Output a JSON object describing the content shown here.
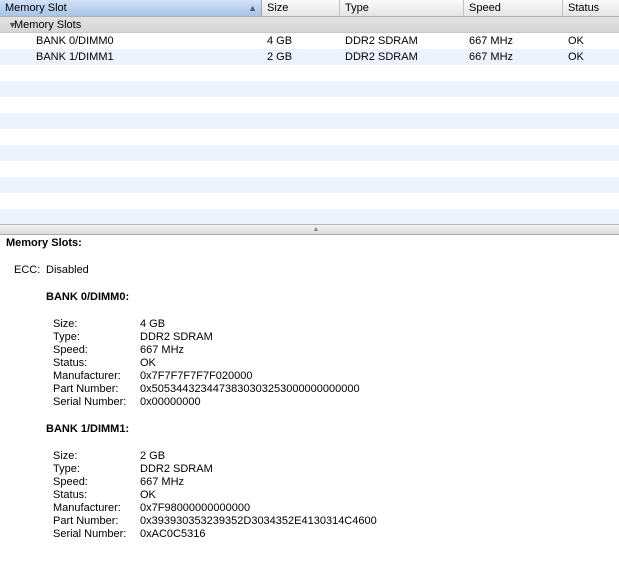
{
  "table": {
    "columns": [
      {
        "label": "Memory Slot"
      },
      {
        "label": "Size"
      },
      {
        "label": "Type"
      },
      {
        "label": "Speed"
      },
      {
        "label": "Status"
      }
    ],
    "group_label": "Memory Slots",
    "rows": [
      {
        "slot": "BANK 0/DIMM0",
        "size": "4 GB",
        "type": "DDR2 SDRAM",
        "speed": "667 MHz",
        "status": "OK"
      },
      {
        "slot": "BANK 1/DIMM1",
        "size": "2 GB",
        "type": "DDR2 SDRAM",
        "speed": "667 MHz",
        "status": "OK"
      }
    ]
  },
  "detail": {
    "title": "Memory Slots:",
    "ecc_label": "ECC:",
    "ecc_value": "Disabled",
    "banks": [
      {
        "title": "BANK 0/DIMM0:",
        "fields": [
          {
            "label": "Size:",
            "value": "4 GB"
          },
          {
            "label": "Type:",
            "value": "DDR2 SDRAM"
          },
          {
            "label": "Speed:",
            "value": "667 MHz"
          },
          {
            "label": "Status:",
            "value": "OK"
          },
          {
            "label": "Manufacturer:",
            "value": "0x7F7F7F7F7F020000"
          },
          {
            "label": "Part Number:",
            "value": "0x5053443234473830303253000000000000"
          },
          {
            "label": "Serial Number:",
            "value": "0x00000000"
          }
        ]
      },
      {
        "title": "BANK 1/DIMM1:",
        "fields": [
          {
            "label": "Size:",
            "value": "2 GB"
          },
          {
            "label": "Type:",
            "value": "DDR2 SDRAM"
          },
          {
            "label": "Speed:",
            "value": "667 MHz"
          },
          {
            "label": "Status:",
            "value": "OK"
          },
          {
            "label": "Manufacturer:",
            "value": "0x7F98000000000000"
          },
          {
            "label": "Part Number:",
            "value": "0x393930353239352D3034352E4130314C4600"
          },
          {
            "label": "Serial Number:",
            "value": "0xAC0C5316"
          }
        ]
      }
    ]
  },
  "icons": {
    "sort": "sort-up-icon",
    "disclosure": "disclosure-down-icon",
    "splitter": "splitter-grip-icon"
  }
}
